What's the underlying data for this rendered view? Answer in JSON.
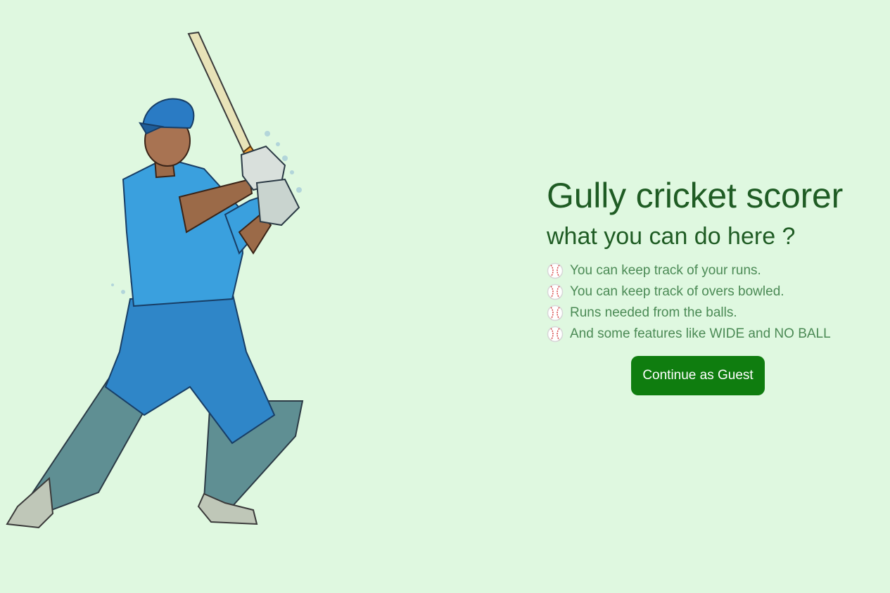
{
  "colors": {
    "background": "#dff8e0",
    "title": "#1f5c24",
    "feature_text": "#4b8a55",
    "button_background": "#0f7d0f",
    "button_text": "#ffffff"
  },
  "illustration": {
    "name": "cricket-batsman-illustration"
  },
  "main": {
    "title": "Gully cricket scorer",
    "subtitle": "what you can do here ?",
    "features": [
      {
        "icon": "baseball-icon",
        "text": "You can keep track of your runs."
      },
      {
        "icon": "baseball-icon",
        "text": "You can keep track of overs bowled."
      },
      {
        "icon": "baseball-icon",
        "text": "Runs needed from the balls."
      },
      {
        "icon": "baseball-icon",
        "text": "And some features like WIDE and NO BALL"
      }
    ],
    "guest_button_label": "Continue as Guest"
  }
}
